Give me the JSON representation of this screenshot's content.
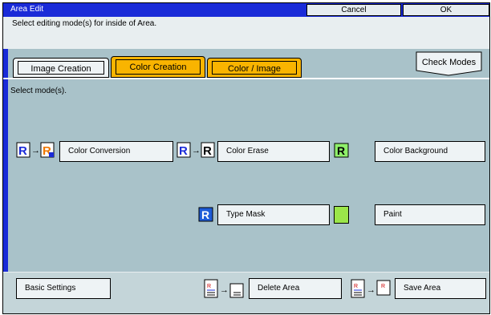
{
  "window": {
    "title": "Area Edit",
    "cancel_label": "Cancel",
    "ok_label": "OK",
    "instruction": "Select editing mode(s) for inside of Area."
  },
  "tabs": [
    {
      "label": "Image Creation",
      "state": "inactive"
    },
    {
      "label": "Color Creation",
      "state": "active"
    },
    {
      "label": "Color / Image",
      "state": "secondary"
    }
  ],
  "check_modes_label": "Check Modes",
  "prompt": "Select mode(s).",
  "modes": {
    "color_conversion": "Color Conversion",
    "color_erase": "Color Erase",
    "color_background": "Color Background",
    "type_mask": "Type Mask",
    "paint": "Paint"
  },
  "icons": {
    "r_letter": "R",
    "small_r": "R"
  },
  "bottom": {
    "basic_settings": "Basic Settings",
    "delete_area": "Delete Area",
    "save_area": "Save Area"
  },
  "colors": {
    "title_bar": "#1a2bd8",
    "panel": "#a9c2c9",
    "active_tab": "#f9b400",
    "paint_swatch": "#9be64a",
    "r_icon_blue": "#1e5cd8",
    "r_icon_green": "#8ff06a"
  }
}
